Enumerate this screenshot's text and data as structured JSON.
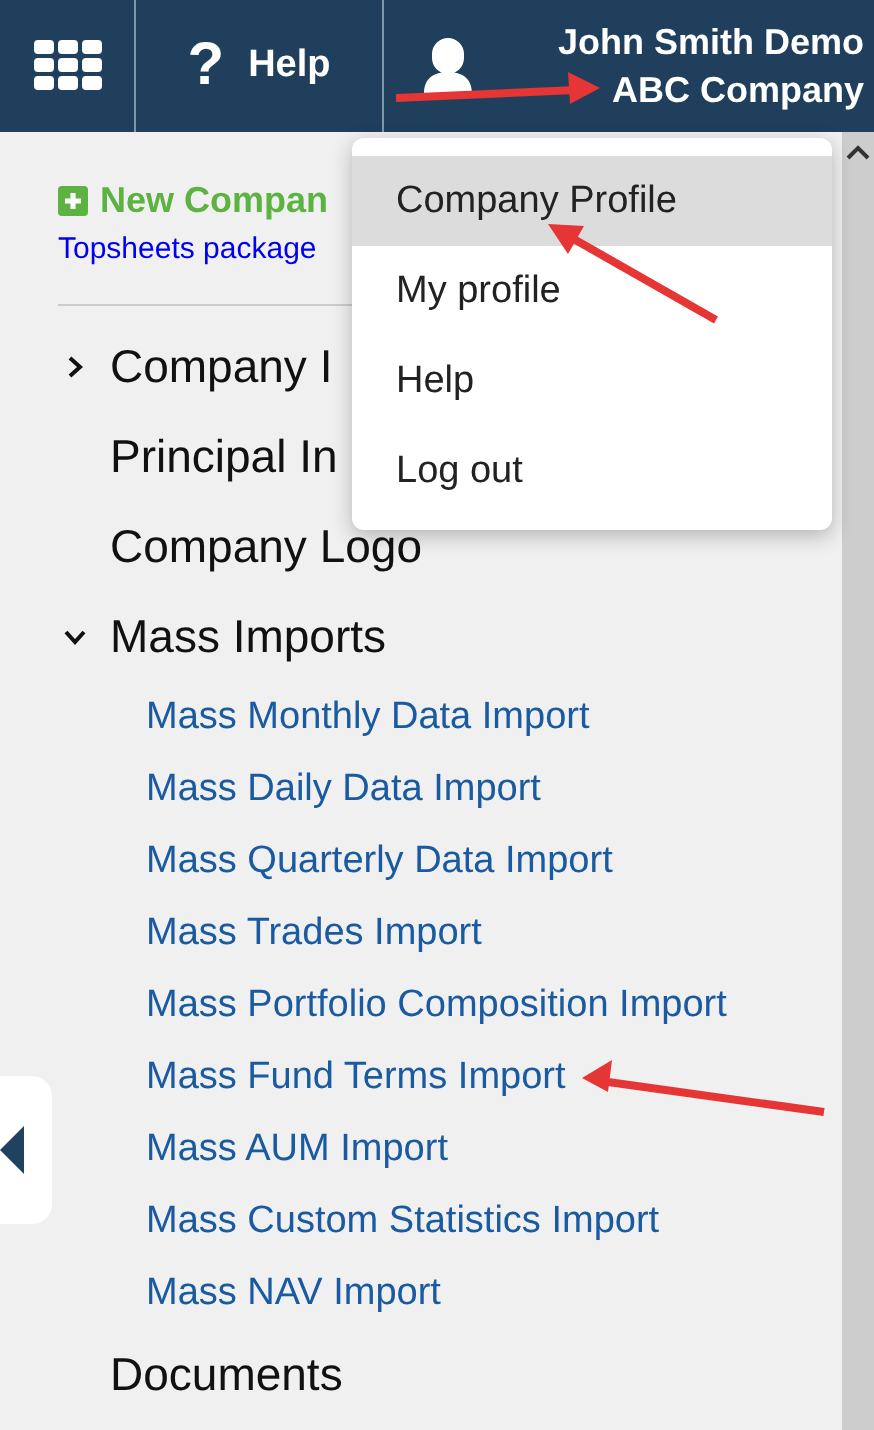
{
  "header": {
    "help_icon": "?",
    "help_label": "Help",
    "user_name": "John Smith Demo",
    "company": "ABC Company"
  },
  "sidebar": {
    "new_company": "New Compan",
    "topsheets_link": "Topsheets package",
    "tree": [
      {
        "label": "Company I",
        "kind": "group",
        "expanded": false
      },
      {
        "label": "Principal In",
        "kind": "leaf"
      },
      {
        "label": "Company Logo",
        "kind": "leaf"
      },
      {
        "label": "Mass Imports",
        "kind": "group",
        "expanded": true,
        "children": [
          {
            "label": "Mass Monthly Data Import"
          },
          {
            "label": "Mass Daily Data Import"
          },
          {
            "label": "Mass Quarterly Data Import"
          },
          {
            "label": "Mass Trades Import"
          },
          {
            "label": "Mass Portfolio Composition Import"
          },
          {
            "label": "Mass Fund Terms Import"
          },
          {
            "label": "Mass AUM Import"
          },
          {
            "label": "Mass Custom Statistics Import"
          },
          {
            "label": "Mass NAV Import"
          }
        ]
      },
      {
        "label": "Documents",
        "kind": "leaf"
      }
    ]
  },
  "user_menu": [
    {
      "label": "Company Profile",
      "selected": true
    },
    {
      "label": "My profile",
      "selected": false
    },
    {
      "label": "Help",
      "selected": false
    },
    {
      "label": "Log out",
      "selected": false
    }
  ]
}
